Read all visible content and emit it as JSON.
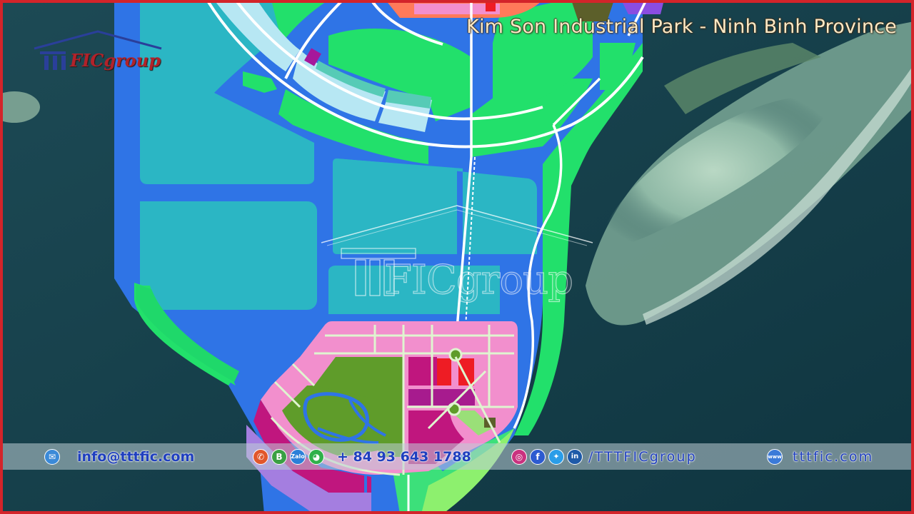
{
  "header": {
    "title": "Kim Son Industrial Park - Ninh Binh Province"
  },
  "logo": {
    "text": "FICgroup",
    "watermark_text": "FICgroup"
  },
  "contact": {
    "email": "info@tttfic.com",
    "phone": "+ 84 93 643 1788",
    "social_handle": "/TTTFICgroup",
    "website": "tttfic.com",
    "contact_icons": [
      "phone-icon",
      "business-chat-icon",
      "zalo-icon",
      "wechat-icon"
    ],
    "social_icons": [
      "instagram-icon",
      "facebook-icon",
      "twitter-icon",
      "linkedin-icon"
    ]
  },
  "colors": {
    "frame": "#d3242a",
    "sea": "#123a45",
    "water_channel": "#2f74e6",
    "industrial_land": "#2bb6c4",
    "green_buffer": "#22e06b",
    "residential_pink": "#f28fcd",
    "commercial_magenta": "#c0167e",
    "commercial_red": "#ee1c24",
    "park_green": "#5f9c2a",
    "contact_text": "#1f3fbf"
  }
}
